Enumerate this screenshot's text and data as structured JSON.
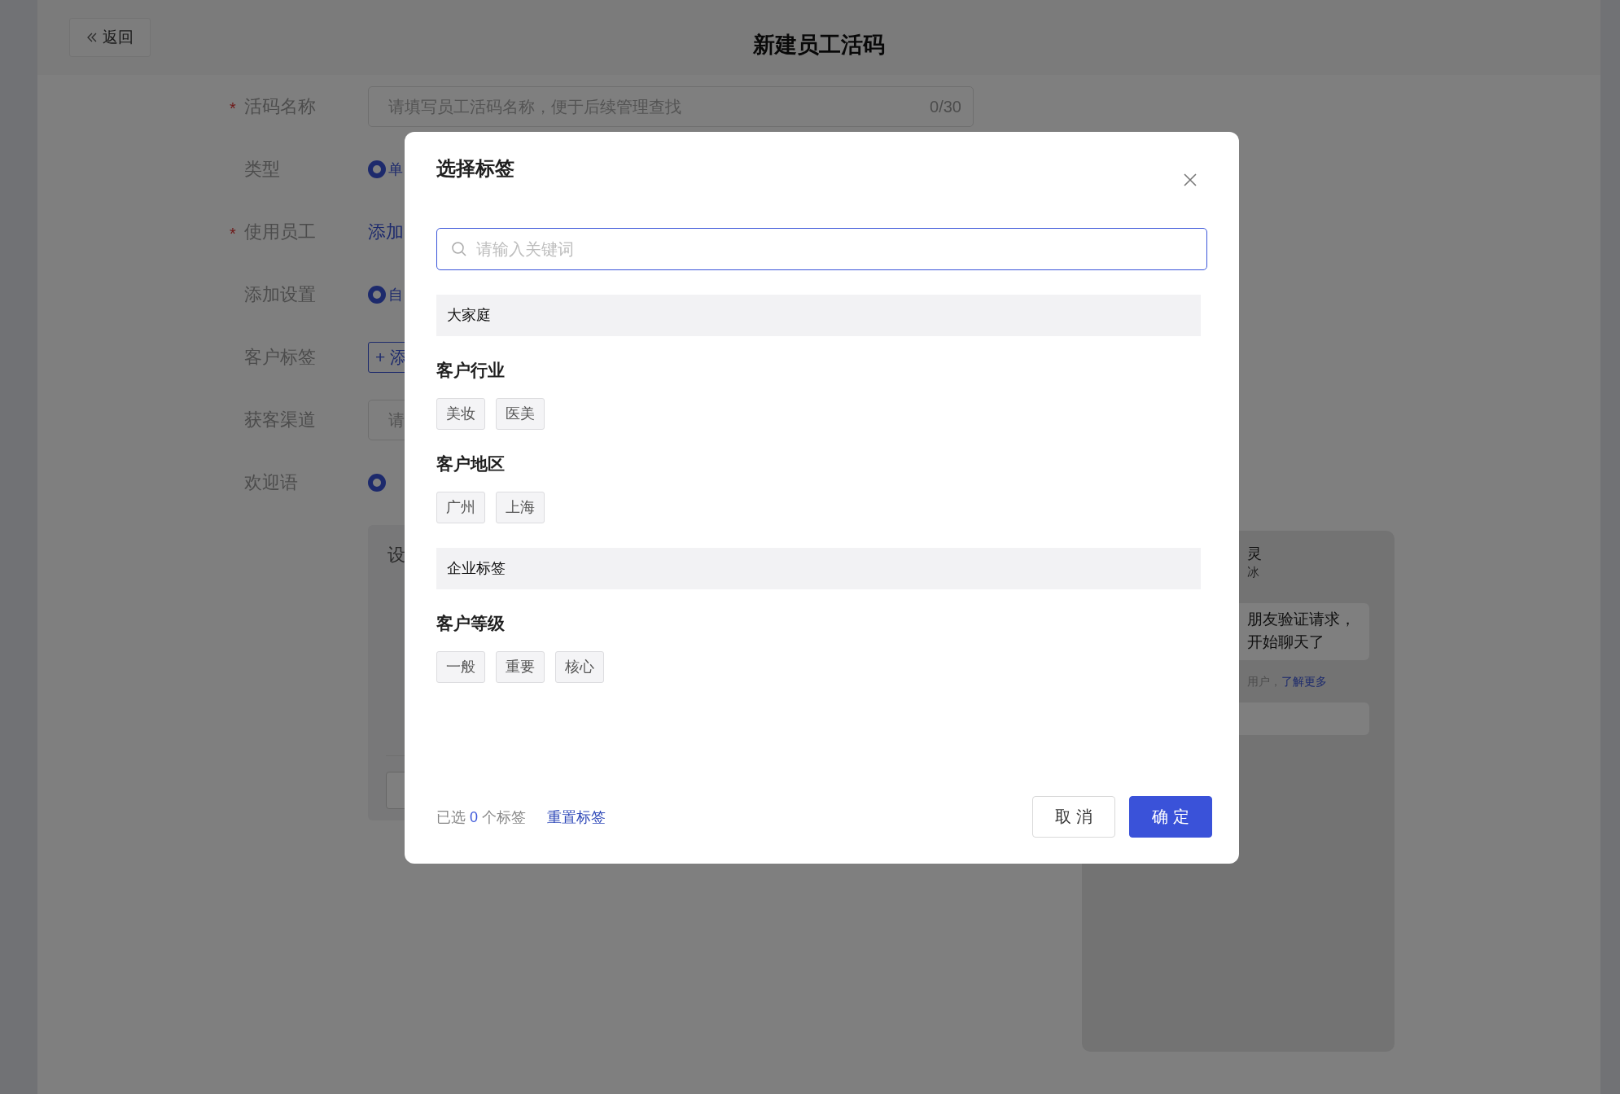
{
  "header": {
    "back_button": "返回",
    "title": "新建员工活码"
  },
  "form": {
    "fields": [
      {
        "label": "活码名称",
        "mark": "*",
        "kind": "input",
        "placeholder": "请填写员工活码名称，便于后续管理查找",
        "counter": "0/30"
      },
      {
        "label": "类型",
        "kind": "radio",
        "selected": true,
        "value": "单"
      },
      {
        "label": "使用员工",
        "mark": "*",
        "kind": "link",
        "value": "添加"
      },
      {
        "label": "添加设置",
        "kind": "radio",
        "selected": true,
        "value": "自"
      },
      {
        "label": "客户标签",
        "kind": "button",
        "value": "+ 添"
      },
      {
        "label": "获客渠道",
        "kind": "input",
        "placeholder": "请"
      },
      {
        "label": "欢迎语",
        "kind": "radio",
        "selected": true
      }
    ],
    "welcome_panel": {
      "text": "设"
    }
  },
  "preview": {
    "name": "灵",
    "subtitle": "冰",
    "bubble": [
      "朋友验证请求，",
      "开始聊天了"
    ],
    "note": "用户，",
    "link": "了解更多"
  },
  "modal": {
    "title": "选择标签",
    "search": {
      "placeholder": "请输入关键词"
    },
    "groups": [
      {
        "name": "大家庭",
        "categories": [
          {
            "name": "客户行业",
            "tags": [
              {
                "label": "美妆",
                "selected": false
              },
              {
                "label": "医美",
                "selected": false
              }
            ]
          },
          {
            "name": "客户地区",
            "tags": [
              {
                "label": "广州",
                "selected": false
              },
              {
                "label": "上海",
                "selected": false
              }
            ]
          }
        ]
      },
      {
        "name": "企业标签",
        "categories": [
          {
            "name": "客户等级",
            "tags": [
              {
                "label": "一般",
                "selected": false
              },
              {
                "label": "重要",
                "selected": false
              },
              {
                "label": "核心",
                "selected": false
              }
            ]
          }
        ]
      }
    ],
    "footer": {
      "summary_prefix": "已选",
      "count": "0",
      "summary_suffix": "个标签",
      "reset_link": "重置标签",
      "cancel_button": "取 消",
      "ok_button": "确 定"
    }
  }
}
